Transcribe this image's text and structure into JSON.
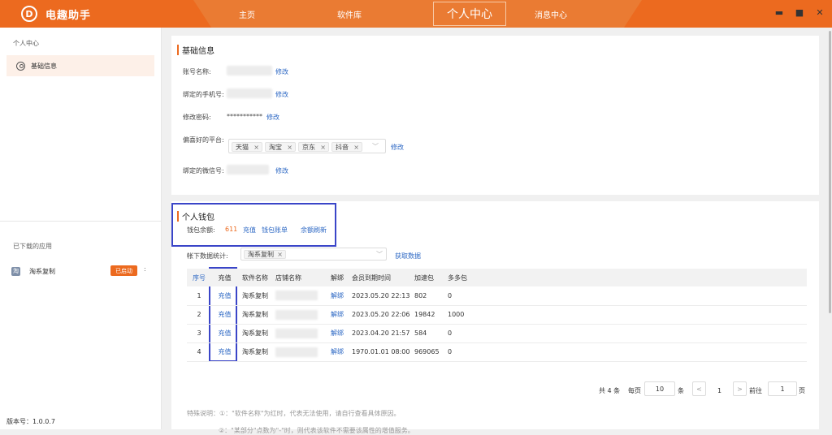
{
  "app": {
    "title": "电趣助手",
    "logo_glyph": "D"
  },
  "nav": {
    "home": "主页",
    "software": "软件库",
    "personal": "个人中心",
    "messages": "消息中心"
  },
  "window": {
    "minimize": "▬",
    "maximize": "■",
    "close": "✕"
  },
  "sidebar": {
    "title": "个人中心",
    "items": [
      {
        "label": "基础信息"
      }
    ],
    "downloaded_title": "已下载的应用",
    "apps": [
      {
        "icon": "淘",
        "name": "淘系复制",
        "status": "已启动",
        "more": ":"
      }
    ],
    "version": "版本号：1.0.0.7"
  },
  "basic_info": {
    "title": "基础信息",
    "account_label": "账号名称:",
    "phone_label": "绑定的手机号:",
    "password_label": "修改密码:",
    "password_mask": "***********",
    "platform_label": "偏喜好的平台:",
    "platforms": [
      "天猫",
      "淘宝",
      "京东",
      "抖音"
    ],
    "wechat_label": "绑定的微信号:",
    "edit_link": "修改"
  },
  "wallet": {
    "title": "个人钱包",
    "balance_label": "钱包余额:",
    "balance_value": "611",
    "recharge_link": "充值",
    "bill_link": "钱包账单",
    "refresh_link": "余额刷新",
    "stats_label": "帐下数据统计:",
    "stats_selected": "淘系复制",
    "fetch_link": "获取数据",
    "table": {
      "headers": [
        "序号",
        "充值",
        "软件名称",
        "店铺名称",
        "解绑",
        "会员到期时间",
        "加速包",
        "多多包"
      ],
      "rows": [
        {
          "idx": "1",
          "charge": "充值",
          "software": "淘系复制",
          "unbind": "解绑",
          "expire": "2023.05.20 22:13",
          "accel": "802",
          "duoduo": "0"
        },
        {
          "idx": "2",
          "charge": "充值",
          "software": "淘系复制",
          "unbind": "解绑",
          "expire": "2023.05.20 22:06",
          "accel": "19842",
          "duoduo": "1000"
        },
        {
          "idx": "3",
          "charge": "充值",
          "software": "淘系复制",
          "unbind": "解绑",
          "expire": "2023.04.20 21:57",
          "accel": "584",
          "duoduo": "0"
        },
        {
          "idx": "4",
          "charge": "充值",
          "software": "淘系复制",
          "unbind": "解绑",
          "expire": "1970.01.01 08:00",
          "accel": "969065",
          "duoduo": "0"
        }
      ]
    },
    "pagination": {
      "total": "共 4 条",
      "per_page_label": "每页",
      "per_page_value": "10",
      "per_page_unit": "条",
      "prev": "<",
      "current_page": "1",
      "next": ">",
      "goto_label": "前往",
      "goto_value": "1",
      "goto_unit": "页"
    },
    "notes": [
      "特殊说明：①：\"软件名称\"为红时，代表无法使用，请自行查看具体原因。",
      "②：\"某部分\"点数为\"-\"时，则代表该软件不需要该属性的增值服务。"
    ]
  },
  "colors": {
    "brand": "#ec6a1f",
    "link": "#2d68c4",
    "highlight": "#3a45c8"
  }
}
